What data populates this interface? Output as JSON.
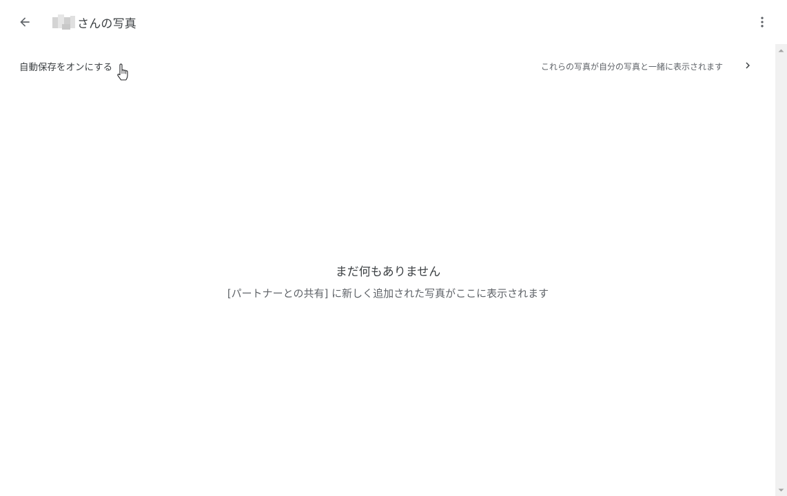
{
  "header": {
    "back_icon": "arrow-left-icon",
    "title": "さんの写真",
    "more_icon": "more-vert-icon"
  },
  "action_row": {
    "autosave_label": "自動保存をオンにする",
    "info_text": "これらの写真が自分の写真と一緒に表示されます",
    "chevron_icon": "chevron-right-icon"
  },
  "empty_state": {
    "title": "まだ何もありません",
    "description": "[パートナーとの共有] に新しく追加された写真がここに表示されます"
  },
  "colors": {
    "text_primary": "#3c4043",
    "text_secondary": "#5f6368",
    "background": "#ffffff",
    "scrollbar_track": "#f1f1f1"
  }
}
